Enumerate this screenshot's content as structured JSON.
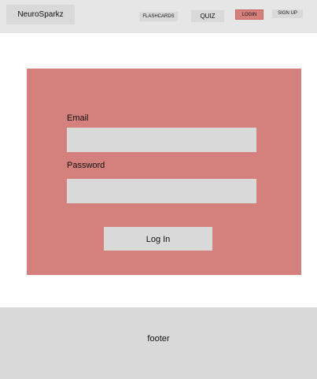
{
  "header": {
    "brand": "NeuroSparkz",
    "nav": {
      "flashcards": "FLASHCARDS",
      "quiz": "QUIZ",
      "login": "LOGIN",
      "signup": "SIGN UP"
    },
    "active_nav": "LOGIN"
  },
  "login_form": {
    "email_label": "Email",
    "email_value": "",
    "password_label": "Password",
    "password_value": "",
    "submit_label": "Log In"
  },
  "footer": {
    "text": "footer"
  },
  "colors": {
    "header_bg": "#e6e6e6",
    "card_bg": "#d4807c",
    "field_bg": "#d9d9d9",
    "footer_bg": "#d9d9d9",
    "active_nav_bg": "#d5807c"
  }
}
